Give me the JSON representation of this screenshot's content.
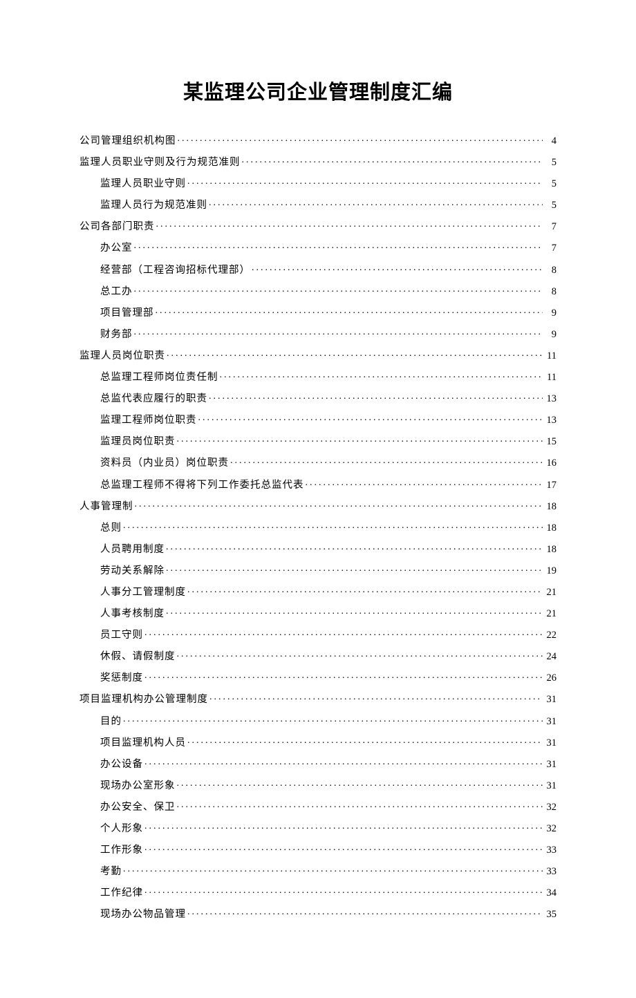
{
  "title": "某监理公司企业管理制度汇编",
  "toc": [
    {
      "level": 1,
      "label": "公司管理组织机构图",
      "page": "4"
    },
    {
      "level": 1,
      "label": "监理人员职业守则及行为规范准则",
      "page": "5"
    },
    {
      "level": 2,
      "label": "监理人员职业守则",
      "page": "5"
    },
    {
      "level": 2,
      "label": "监理人员行为规范准则",
      "page": "5"
    },
    {
      "level": 1,
      "label": "公司各部门职责",
      "page": "7"
    },
    {
      "level": 2,
      "label": "办公室",
      "page": "7"
    },
    {
      "level": 2,
      "label": "经营部（工程咨询招标代理部）",
      "page": "8"
    },
    {
      "level": 2,
      "label": "总工办",
      "page": "8"
    },
    {
      "level": 2,
      "label": "项目管理部",
      "page": "9"
    },
    {
      "level": 2,
      "label": "财务部",
      "page": "9"
    },
    {
      "level": 1,
      "label": "监理人员岗位职责",
      "page": "11"
    },
    {
      "level": 2,
      "label": "总监理工程师岗位责任制",
      "page": "11"
    },
    {
      "level": 2,
      "label": "总监代表应履行的职责",
      "page": "13"
    },
    {
      "level": 2,
      "label": "监理工程师岗位职责",
      "page": "13"
    },
    {
      "level": 2,
      "label": "监理员岗位职责",
      "page": "15"
    },
    {
      "level": 2,
      "label": "资料员（内业员）岗位职责",
      "page": "16"
    },
    {
      "level": 2,
      "label": "总监理工程师不得将下列工作委托总监代表",
      "page": "17"
    },
    {
      "level": 1,
      "label": "人事管理制",
      "page": "18"
    },
    {
      "level": 2,
      "label": "总则",
      "page": "18"
    },
    {
      "level": 2,
      "label": "人员聘用制度",
      "page": "18"
    },
    {
      "level": 2,
      "label": "劳动关系解除",
      "page": "19"
    },
    {
      "level": 2,
      "label": "人事分工管理制度",
      "page": "21"
    },
    {
      "level": 2,
      "label": "人事考核制度",
      "page": "21"
    },
    {
      "level": 2,
      "label": "员工守则",
      "page": "22"
    },
    {
      "level": 2,
      "label": "休假、请假制度",
      "page": "24"
    },
    {
      "level": 2,
      "label": "奖惩制度",
      "page": "26"
    },
    {
      "level": 1,
      "label": "项目监理机构办公管理制度",
      "page": "31"
    },
    {
      "level": 2,
      "label": "目的",
      "page": "31"
    },
    {
      "level": 2,
      "label": "项目监理机构人员",
      "page": "31"
    },
    {
      "level": 2,
      "label": "办公设备",
      "page": "31"
    },
    {
      "level": 2,
      "label": "现场办公室形象",
      "page": "31"
    },
    {
      "level": 2,
      "label": "办公安全、保卫",
      "page": "32"
    },
    {
      "level": 2,
      "label": "个人形象",
      "page": "32"
    },
    {
      "level": 2,
      "label": "工作形象",
      "page": "33"
    },
    {
      "level": 2,
      "label": "考勤",
      "page": "33"
    },
    {
      "level": 2,
      "label": "工作纪律",
      "page": "34"
    },
    {
      "level": 2,
      "label": "现场办公物品管理",
      "page": "35"
    }
  ]
}
